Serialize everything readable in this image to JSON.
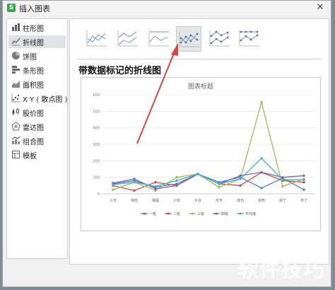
{
  "window": {
    "title": "插入图表",
    "close_glyph": "✕"
  },
  "sidebar": {
    "items": [
      {
        "label": "柱形图",
        "icon": "column-chart-icon"
      },
      {
        "label": "折线图",
        "icon": "line-chart-icon",
        "selected": true
      },
      {
        "label": "饼图",
        "icon": "pie-chart-icon"
      },
      {
        "label": "条形图",
        "icon": "bar-chart-icon"
      },
      {
        "label": "面积图",
        "icon": "area-chart-icon"
      },
      {
        "label": "X Y ( 散点图 )",
        "icon": "scatter-chart-icon"
      },
      {
        "label": "股价图",
        "icon": "stock-chart-icon"
      },
      {
        "label": "雷达图",
        "icon": "radar-chart-icon"
      },
      {
        "label": "组合图",
        "icon": "combo-chart-icon"
      },
      {
        "label": "模板",
        "icon": "template-icon"
      }
    ]
  },
  "subtypes": {
    "count": 6,
    "selected_index": 3,
    "names": [
      "line",
      "stacked-line",
      "percent-stacked-line",
      "line-with-markers",
      "stacked-line-with-markers",
      "percent-stacked-line-with-markers"
    ]
  },
  "main": {
    "heading": "带数据标记的折线图"
  },
  "watermark": "软件技巧",
  "colors": {
    "arrow": "#d9453f",
    "accent": "#3aa653"
  },
  "chart_data": {
    "type": "line",
    "title": "图表标题",
    "categories": [
      "小天",
      "易晗",
      "瑞福",
      "小玩",
      "大卉",
      "天宇",
      "成功",
      "张燕",
      "胡了",
      "未了"
    ],
    "ylim": [
      0,
      600
    ],
    "yticks": [
      0,
      100,
      200,
      300,
      400,
      500,
      600
    ],
    "grid": true,
    "legend_position": "bottom",
    "series": [
      {
        "name": "一班",
        "color": "#4f81bd",
        "values": [
          60,
          80,
          40,
          60,
          120,
          70,
          100,
          35,
          95,
          25
        ]
      },
      {
        "name": "二班",
        "color": "#c0504d",
        "values": [
          50,
          20,
          70,
          50,
          120,
          60,
          50,
          130,
          80,
          70
        ]
      },
      {
        "name": "三班",
        "color": "#9bbb59",
        "values": [
          25,
          70,
          20,
          100,
          120,
          40,
          90,
          555,
          45,
          90
        ]
      },
      {
        "name": "四班",
        "color": "#8064a2",
        "values": [
          65,
          90,
          30,
          50,
          120,
          60,
          110,
          130,
          100,
          110
        ]
      },
      {
        "name": "平均值",
        "color": "#4bacc6",
        "values": [
          55,
          70,
          45,
          80,
          120,
          60,
          90,
          215,
          85,
          85
        ]
      }
    ]
  }
}
